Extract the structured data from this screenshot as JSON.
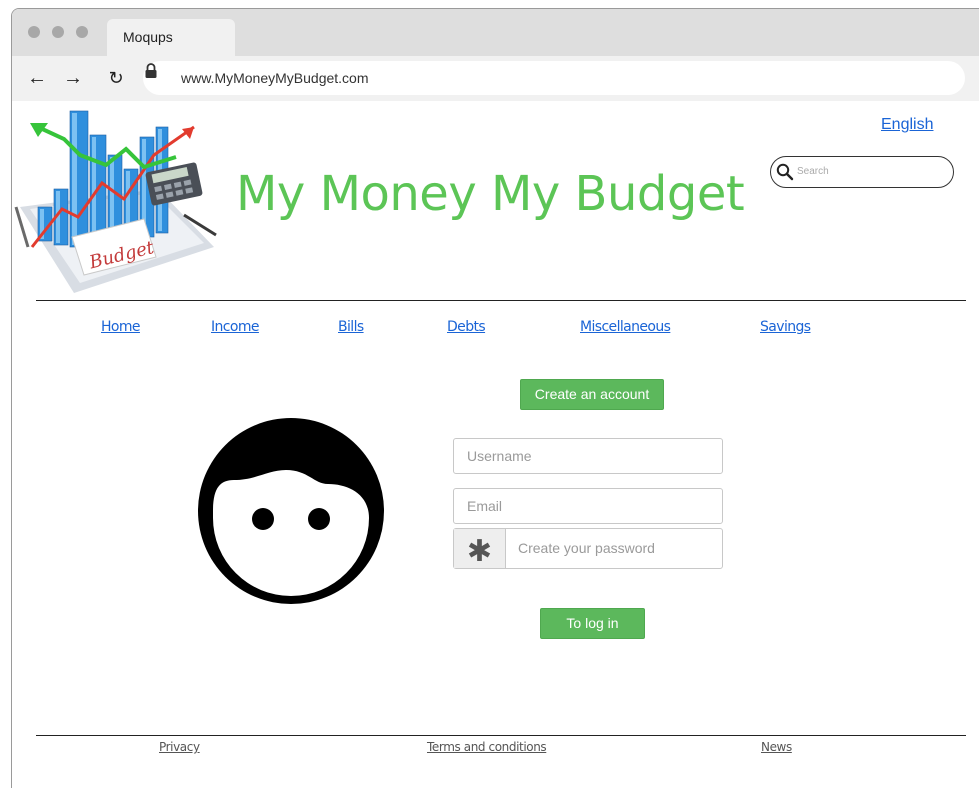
{
  "browser": {
    "tab_title": "Moqups",
    "url": "www.MyMoneyMyBudget.com"
  },
  "header": {
    "site_title": "My Money My Budget",
    "language": "English",
    "search_placeholder": "Search"
  },
  "nav": {
    "items": [
      "Home",
      "Income",
      "Bills",
      "Debts",
      "Miscellaneous",
      "Savings"
    ]
  },
  "form": {
    "create_account_label": "Create an account",
    "username_placeholder": "Username",
    "email_placeholder": "Email",
    "password_placeholder": "Create your password",
    "login_label": "To log in"
  },
  "footer": {
    "links": [
      "Privacy",
      "Terms and conditions",
      "News"
    ]
  },
  "logo_text": "Budget",
  "colors": {
    "brand_green": "#5cc556",
    "button_green": "#5cb85c",
    "link_blue": "#1a64d6"
  }
}
